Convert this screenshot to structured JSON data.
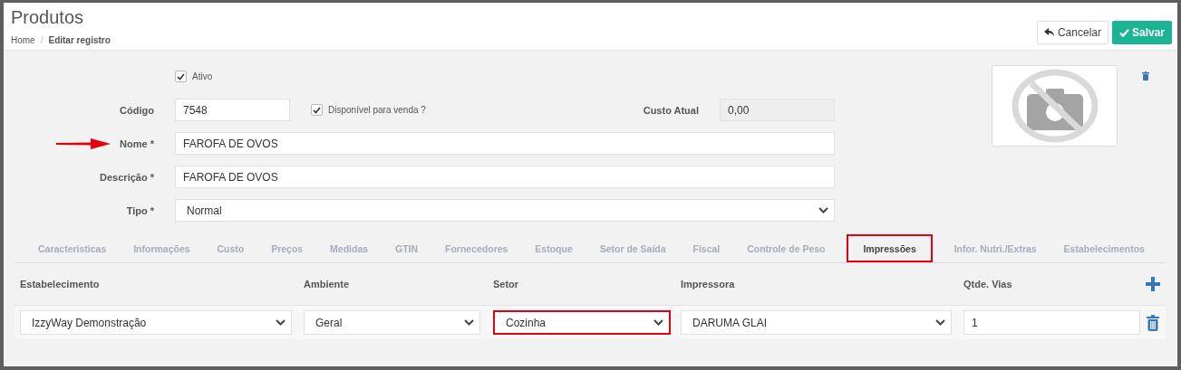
{
  "page": {
    "title": "Produtos",
    "breadcrumb_separator": "/",
    "breadcrumb": [
      {
        "label": "Home"
      },
      {
        "label": "Editar registro"
      }
    ]
  },
  "actions": [
    {
      "label": "Cancelar",
      "kind": "cancel"
    },
    {
      "label": "Salvar",
      "kind": "save"
    }
  ],
  "form": {
    "ativo": {
      "label": "Ativo",
      "checked": true
    },
    "codigo": {
      "label": "Código",
      "value": "7548"
    },
    "disponivel": {
      "label": "Disponível para venda ?",
      "checked": true
    },
    "custo": {
      "label": "Custo Atual",
      "value": "0,00",
      "disabled": true
    },
    "nome": {
      "label": "Nome *",
      "value": "FAROFA DE OVOS",
      "annotated": true
    },
    "descricao": {
      "label": "Descrição *",
      "value": "FAROFA DE OVOS"
    },
    "tipo": {
      "label": "Tipo *",
      "value": "Normal"
    }
  },
  "tabs": [
    {
      "label": "Caracteristicas",
      "selected": false
    },
    {
      "label": "Informações",
      "selected": false
    },
    {
      "label": "Custo",
      "selected": false
    },
    {
      "label": "Preços",
      "selected": false
    },
    {
      "label": "Medidas",
      "selected": false
    },
    {
      "label": "GTIN",
      "selected": false
    },
    {
      "label": "Fornecedores",
      "selected": false
    },
    {
      "label": "Estoque",
      "selected": false
    },
    {
      "label": "Setor de Saída",
      "selected": false
    },
    {
      "label": "Fiscal",
      "selected": false
    },
    {
      "label": "Controle de Peso",
      "selected": false
    },
    {
      "label": "Impressões",
      "selected": true
    },
    {
      "label": "Infor. Nutri./Extras",
      "selected": false
    },
    {
      "label": "Estabelecimentos",
      "selected": false
    }
  ],
  "table": {
    "columns": [
      {
        "label": "Estabelecimento"
      },
      {
        "label": "Ambiente"
      },
      {
        "label": "Setor"
      },
      {
        "label": "Impressora"
      },
      {
        "label": "Qtde. Vias"
      }
    ],
    "rows": [
      {
        "cells": [
          {
            "kind": "select",
            "value": "IzzyWay Demonstração",
            "highlighted": false
          },
          {
            "kind": "select",
            "value": "Geral",
            "highlighted": false
          },
          {
            "kind": "select",
            "value": "Cozinha",
            "highlighted": true
          },
          {
            "kind": "select",
            "value": "DARUMA GLAI",
            "highlighted": false
          },
          {
            "kind": "input",
            "value": "1",
            "highlighted": false
          }
        ]
      }
    ]
  }
}
